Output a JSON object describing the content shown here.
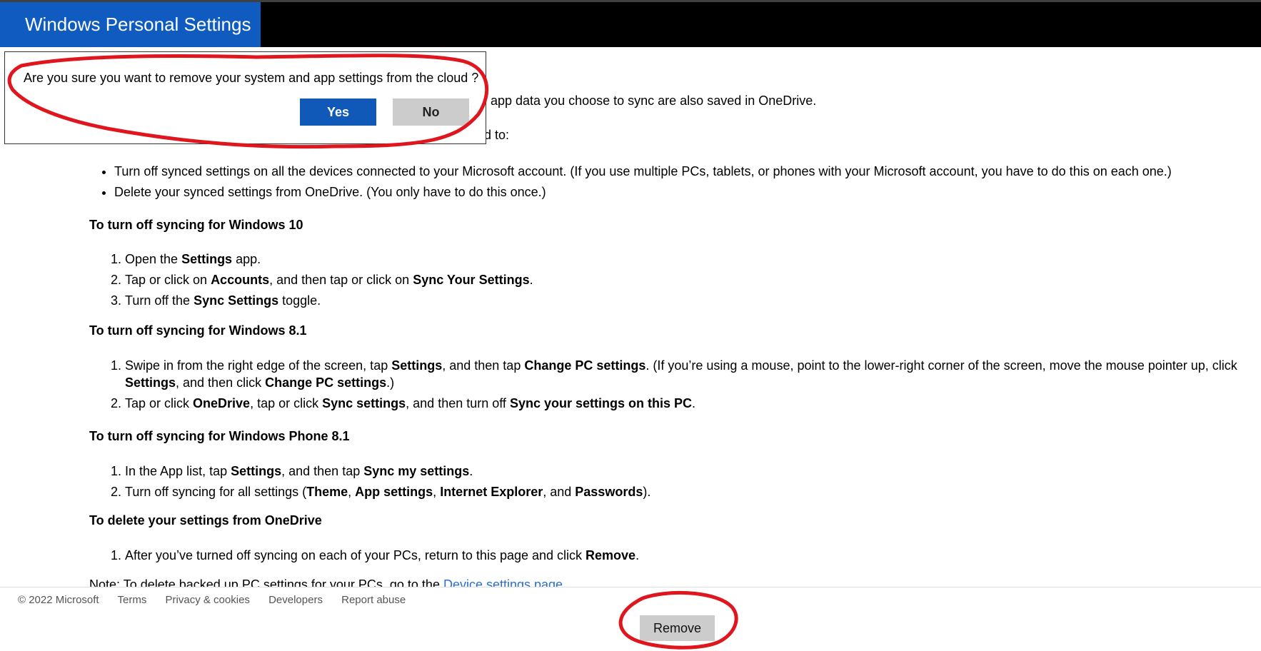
{
  "header": {
    "title": "Windows Personal Settings"
  },
  "dialog": {
    "message": "Are you sure you want to remove your system and app settings from the cloud ?",
    "yes_label": "Yes",
    "no_label": "No"
  },
  "content": {
    "intro_partial": "l app data you choose to sync are also saved in OneDrive.",
    "need_to_partial": "d to:",
    "bullets": [
      "Turn off synced settings on all the devices connected to your Microsoft account. (If you use multiple PCs, tablets, or phones with your Microsoft account, you have to do this on each one.)",
      "Delete your synced settings from OneDrive. (You only have to do this once.)"
    ],
    "win10": {
      "heading": "To turn off syncing for Windows 10",
      "s1_pre": "Open the ",
      "s1_b1": "Settings",
      "s1_post": " app.",
      "s2_pre": "Tap or click on ",
      "s2_b1": "Accounts",
      "s2_mid": ", and then tap or click on ",
      "s2_b2": "Sync Your Settings",
      "s2_post": ".",
      "s3_pre": "Turn off the ",
      "s3_b1": "Sync Settings",
      "s3_post": " toggle."
    },
    "win81": {
      "heading": "To turn off syncing for Windows 8.1",
      "s1_pre": "Swipe in from the right edge of the screen, tap ",
      "s1_b1": "Settings",
      "s1_mid1": ", and then tap ",
      "s1_b2": "Change PC settings",
      "s1_mid2": ". (If you’re using a mouse, point to the lower-right corner of the screen, move the mouse pointer up, click ",
      "s1_b3": "Settings",
      "s1_mid3": ", and then click ",
      "s1_b4": "Change PC settings",
      "s1_post": ".)",
      "s2_pre": "Tap or click ",
      "s2_b1": "OneDrive",
      "s2_mid1": ", tap or click ",
      "s2_b2": "Sync settings",
      "s2_mid2": ", and then turn off ",
      "s2_b3": "Sync your settings on this PC",
      "s2_post": "."
    },
    "wp81": {
      "heading": "To turn off syncing for Windows Phone 8.1",
      "s1_pre": "In the App list, tap ",
      "s1_b1": "Settings",
      "s1_mid": ", and then tap ",
      "s1_b2": "Sync my settings",
      "s1_post": ".",
      "s2_pre": "Turn off syncing for all settings (",
      "s2_b1": "Theme",
      "s2_sep1": ", ",
      "s2_b2": "App settings",
      "s2_sep2": ", ",
      "s2_b3": "Internet Explorer",
      "s2_sep3": ", and ",
      "s2_b4": "Passwords",
      "s2_post": ")."
    },
    "delete": {
      "heading": "To delete your settings from OneDrive",
      "s1_pre": "After you’ve turned off syncing on each of your PCs, return to this page and click ",
      "s1_b1": "Remove",
      "s1_post": "."
    },
    "note_pre": "Note: To delete backed up PC settings for your PCs, go to the ",
    "note_link": "Device settings page"
  },
  "footer": {
    "copyright": "© 2022 Microsoft",
    "links": [
      "Terms",
      "Privacy & cookies",
      "Developers",
      "Report abuse"
    ]
  },
  "actions": {
    "remove_label": "Remove"
  },
  "annotation_color": "#e0161e"
}
